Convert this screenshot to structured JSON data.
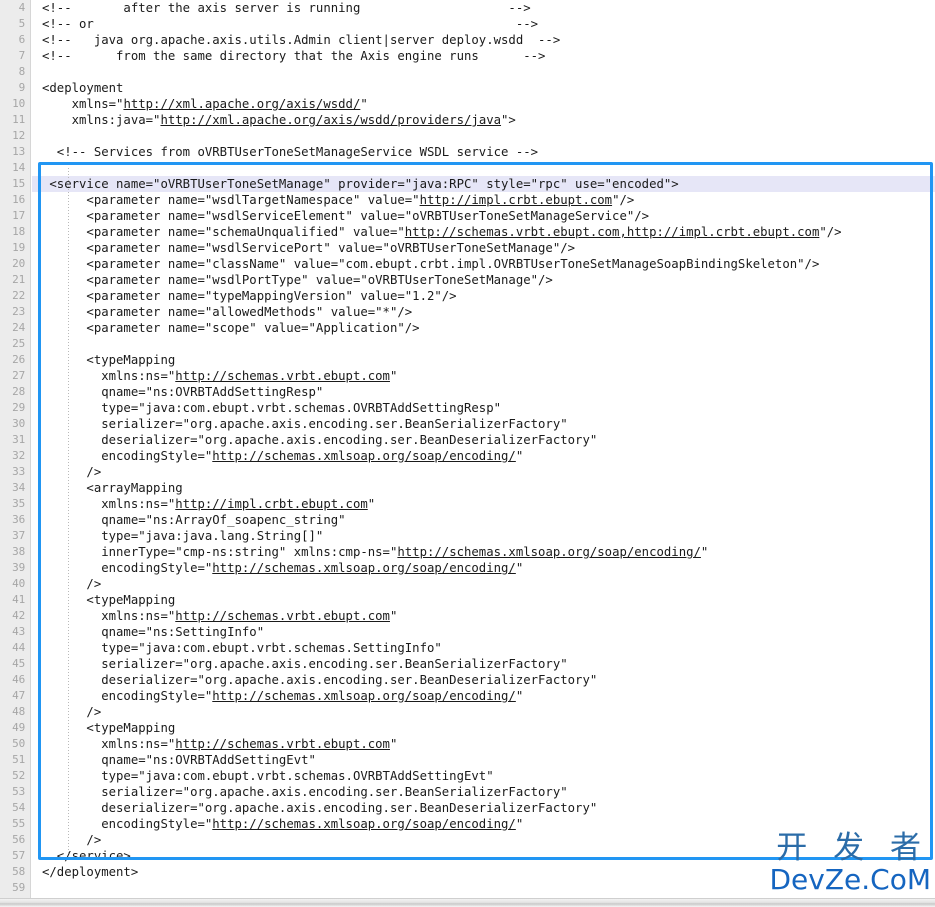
{
  "editor": {
    "first_visible_line": 4,
    "last_visible_line": 59,
    "language": "xml",
    "selection_line": 15,
    "colors": {
      "gutter_bg": "#ececec",
      "gutter_text": "#a6a6a6",
      "code_bg": "#ffffff",
      "code_text": "#1a1a1a",
      "current_line_bg": "#e6e6f7",
      "caret": "#7a3ea8",
      "highlight_box_border": "#2196f3",
      "link_underline": "#1a1a1a",
      "watermark_cn": "#2b6ca8",
      "watermark_en": "#1565c0"
    }
  },
  "lines": [
    {
      "n": 4,
      "text": "<!--       after the axis server is running                    -->"
    },
    {
      "n": 5,
      "text": "<!-- or                                                         -->"
    },
    {
      "n": 6,
      "text": "<!--   java org.apache.axis.utils.Admin client|server deploy.wsdd  -->"
    },
    {
      "n": 7,
      "text": "<!--      from the same directory that the Axis engine runs      -->"
    },
    {
      "n": 8,
      "text": ""
    },
    {
      "n": 9,
      "text": "<deployment"
    },
    {
      "n": 10,
      "text": "    xmlns=\"http://xml.apache.org/axis/wsdd/\""
    },
    {
      "n": 11,
      "text": "    xmlns:java=\"http://xml.apache.org/axis/wsdd/providers/java\">"
    },
    {
      "n": 12,
      "text": ""
    },
    {
      "n": 13,
      "text": "  <!-- Services from oVRBTUserToneSetManageService WSDL service -->"
    },
    {
      "n": 14,
      "text": ""
    },
    {
      "n": 15,
      "text": " <service name=\"oVRBTUserToneSetManage\" provider=\"java:RPC\" style=\"rpc\" use=\"encoded\">"
    },
    {
      "n": 16,
      "text": "      <parameter name=\"wsdlTargetNamespace\" value=\"http://impl.crbt.ebupt.com\"/>"
    },
    {
      "n": 17,
      "text": "      <parameter name=\"wsdlServiceElement\" value=\"oVRBTUserToneSetManageService\"/>"
    },
    {
      "n": 18,
      "text": "      <parameter name=\"schemaUnqualified\" value=\"http://schemas.vrbt.ebupt.com,http://impl.crbt.ebupt.com\"/>"
    },
    {
      "n": 19,
      "text": "      <parameter name=\"wsdlServicePort\" value=\"oVRBTUserToneSetManage\"/>"
    },
    {
      "n": 20,
      "text": "      <parameter name=\"className\" value=\"com.ebupt.crbt.impl.OVRBTUserToneSetManageSoapBindingSkeleton\"/>"
    },
    {
      "n": 21,
      "text": "      <parameter name=\"wsdlPortType\" value=\"oVRBTUserToneSetManage\"/>"
    },
    {
      "n": 22,
      "text": "      <parameter name=\"typeMappingVersion\" value=\"1.2\"/>"
    },
    {
      "n": 23,
      "text": "      <parameter name=\"allowedMethods\" value=\"*\"/>"
    },
    {
      "n": 24,
      "text": "      <parameter name=\"scope\" value=\"Application\"/>"
    },
    {
      "n": 25,
      "text": ""
    },
    {
      "n": 26,
      "text": "      <typeMapping"
    },
    {
      "n": 27,
      "text": "        xmlns:ns=\"http://schemas.vrbt.ebupt.com\""
    },
    {
      "n": 28,
      "text": "        qname=\"ns:OVRBTAddSettingResp\""
    },
    {
      "n": 29,
      "text": "        type=\"java:com.ebupt.vrbt.schemas.OVRBTAddSettingResp\""
    },
    {
      "n": 30,
      "text": "        serializer=\"org.apache.axis.encoding.ser.BeanSerializerFactory\""
    },
    {
      "n": 31,
      "text": "        deserializer=\"org.apache.axis.encoding.ser.BeanDeserializerFactory\""
    },
    {
      "n": 32,
      "text": "        encodingStyle=\"http://schemas.xmlsoap.org/soap/encoding/\""
    },
    {
      "n": 33,
      "text": "      />"
    },
    {
      "n": 34,
      "text": "      <arrayMapping"
    },
    {
      "n": 35,
      "text": "        xmlns:ns=\"http://impl.crbt.ebupt.com\""
    },
    {
      "n": 36,
      "text": "        qname=\"ns:ArrayOf_soapenc_string\""
    },
    {
      "n": 37,
      "text": "        type=\"java:java.lang.String[]\""
    },
    {
      "n": 38,
      "text": "        innerType=\"cmp-ns:string\" xmlns:cmp-ns=\"http://schemas.xmlsoap.org/soap/encoding/\""
    },
    {
      "n": 39,
      "text": "        encodingStyle=\"http://schemas.xmlsoap.org/soap/encoding/\""
    },
    {
      "n": 40,
      "text": "      />"
    },
    {
      "n": 41,
      "text": "      <typeMapping"
    },
    {
      "n": 42,
      "text": "        xmlns:ns=\"http://schemas.vrbt.ebupt.com\""
    },
    {
      "n": 43,
      "text": "        qname=\"ns:SettingInfo\""
    },
    {
      "n": 44,
      "text": "        type=\"java:com.ebupt.vrbt.schemas.SettingInfo\""
    },
    {
      "n": 45,
      "text": "        serializer=\"org.apache.axis.encoding.ser.BeanSerializerFactory\""
    },
    {
      "n": 46,
      "text": "        deserializer=\"org.apache.axis.encoding.ser.BeanDeserializerFactory\""
    },
    {
      "n": 47,
      "text": "        encodingStyle=\"http://schemas.xmlsoap.org/soap/encoding/\""
    },
    {
      "n": 48,
      "text": "      />"
    },
    {
      "n": 49,
      "text": "      <typeMapping"
    },
    {
      "n": 50,
      "text": "        xmlns:ns=\"http://schemas.vrbt.ebupt.com\""
    },
    {
      "n": 51,
      "text": "        qname=\"ns:OVRBTAddSettingEvt\""
    },
    {
      "n": 52,
      "text": "        type=\"java:com.ebupt.vrbt.schemas.OVRBTAddSettingEvt\""
    },
    {
      "n": 53,
      "text": "        serializer=\"org.apache.axis.encoding.ser.BeanSerializerFactory\""
    },
    {
      "n": 54,
      "text": "        deserializer=\"org.apache.axis.encoding.ser.BeanDeserializerFactory\""
    },
    {
      "n": 55,
      "text": "        encodingStyle=\"http://schemas.xmlsoap.org/soap/encoding/\""
    },
    {
      "n": 56,
      "text": "      />"
    },
    {
      "n": 57,
      "text": "  </service>"
    },
    {
      "n": 58,
      "text": "</deployment>"
    },
    {
      "n": 59,
      "text": ""
    }
  ],
  "underlined_urls": [
    "http://xml.apache.org/axis/wsdd/",
    "http://xml.apache.org/axis/wsdd/providers/java",
    "http://impl.crbt.ebupt.com",
    "http://schemas.vrbt.ebupt.com,http://impl.crbt.ebupt.com",
    "http://schemas.vrbt.ebupt.com",
    "http://schemas.xmlsoap.org/soap/encoding/"
  ],
  "watermark": {
    "cn": "开 发 者",
    "en": "DevZe.CoM"
  }
}
